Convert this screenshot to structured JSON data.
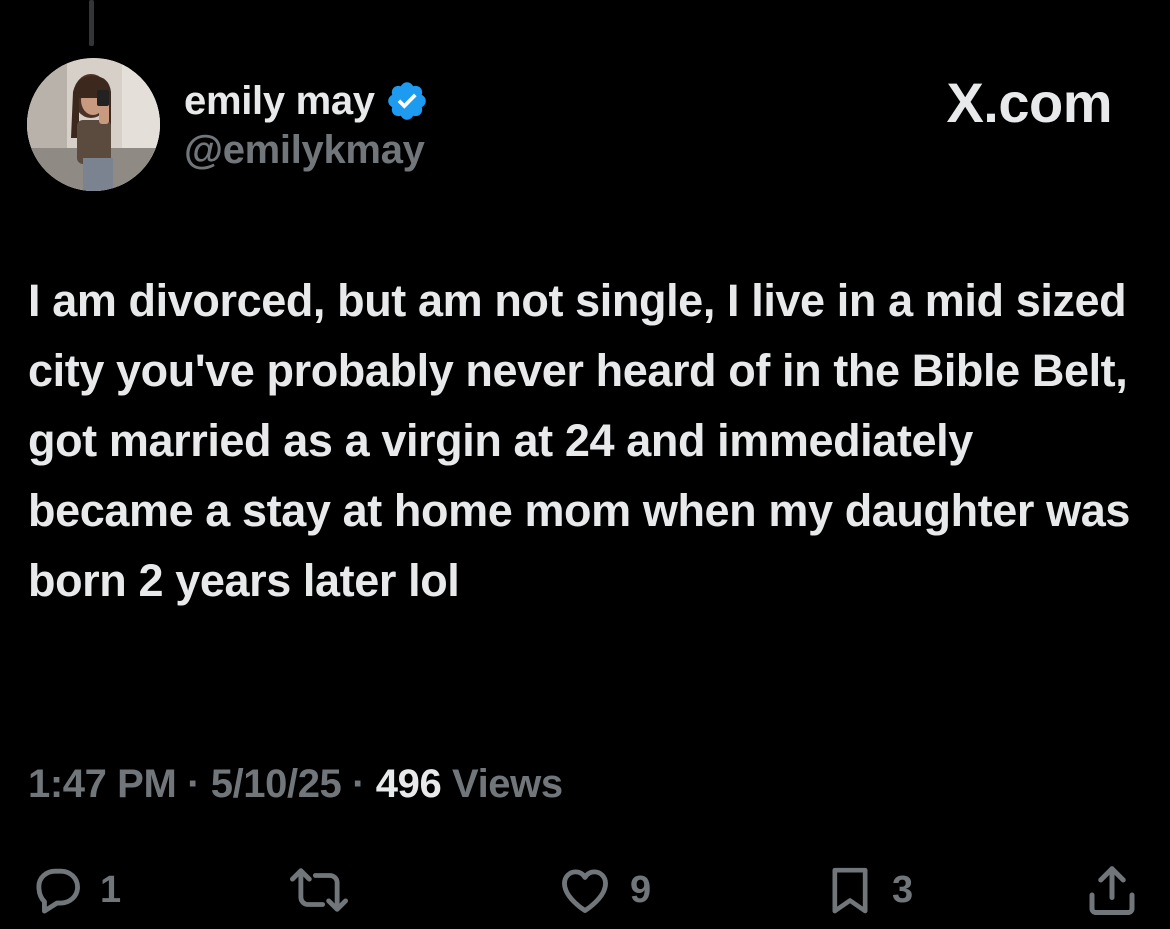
{
  "brand": {
    "label": "X.com"
  },
  "author": {
    "display_name": "emily may",
    "handle": "@emilykmay",
    "verified": true,
    "verified_color": "#1d9bf0",
    "avatar_icon": "profile-photo"
  },
  "tweet": {
    "text": "I am divorced, but am not single, I live in a mid sized city you've probably never heard of in the Bible Belt, got married as a virgin at 24 and immediately became a stay at home mom when my daughter was born 2 years later lol"
  },
  "meta": {
    "time": "1:47 PM",
    "separator": "·",
    "date": "5/10/25",
    "views_count": "496",
    "views_label": "Views"
  },
  "actions": {
    "replies": {
      "icon": "reply-icon",
      "count": "1"
    },
    "reposts": {
      "icon": "repost-icon",
      "count": ""
    },
    "likes": {
      "icon": "like-icon",
      "count": "9"
    },
    "bookmarks": {
      "icon": "bookmark-icon",
      "count": "3"
    },
    "share": {
      "icon": "share-icon"
    }
  },
  "colors": {
    "background": "#000000",
    "primary_text": "#e7e9ea",
    "secondary_text": "#71767b"
  }
}
